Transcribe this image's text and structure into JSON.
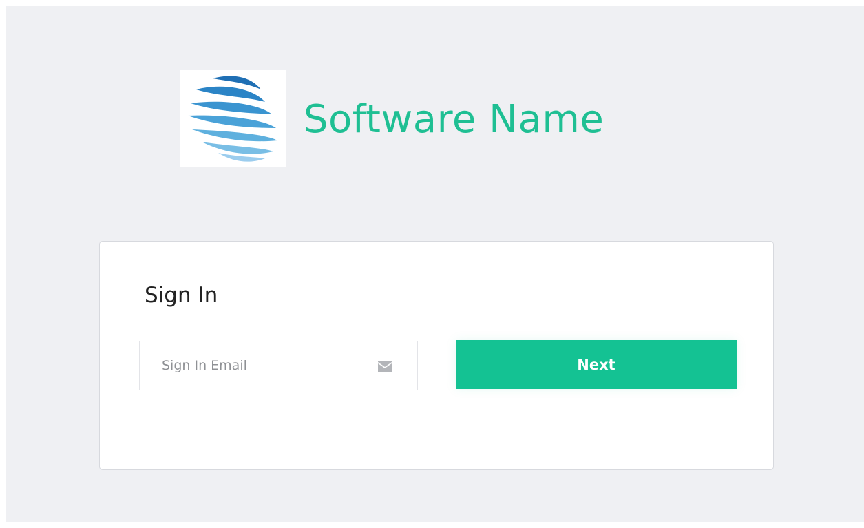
{
  "brand": {
    "name": "Software Name",
    "logo_icon": "striped-globe-logo",
    "accent_color": "#1fbf93"
  },
  "signin": {
    "title": "Sign In",
    "email_placeholder": "Sign In Email",
    "email_value": "",
    "email_icon": "envelope-icon",
    "next_label": "Next",
    "button_color": "#14c293"
  }
}
